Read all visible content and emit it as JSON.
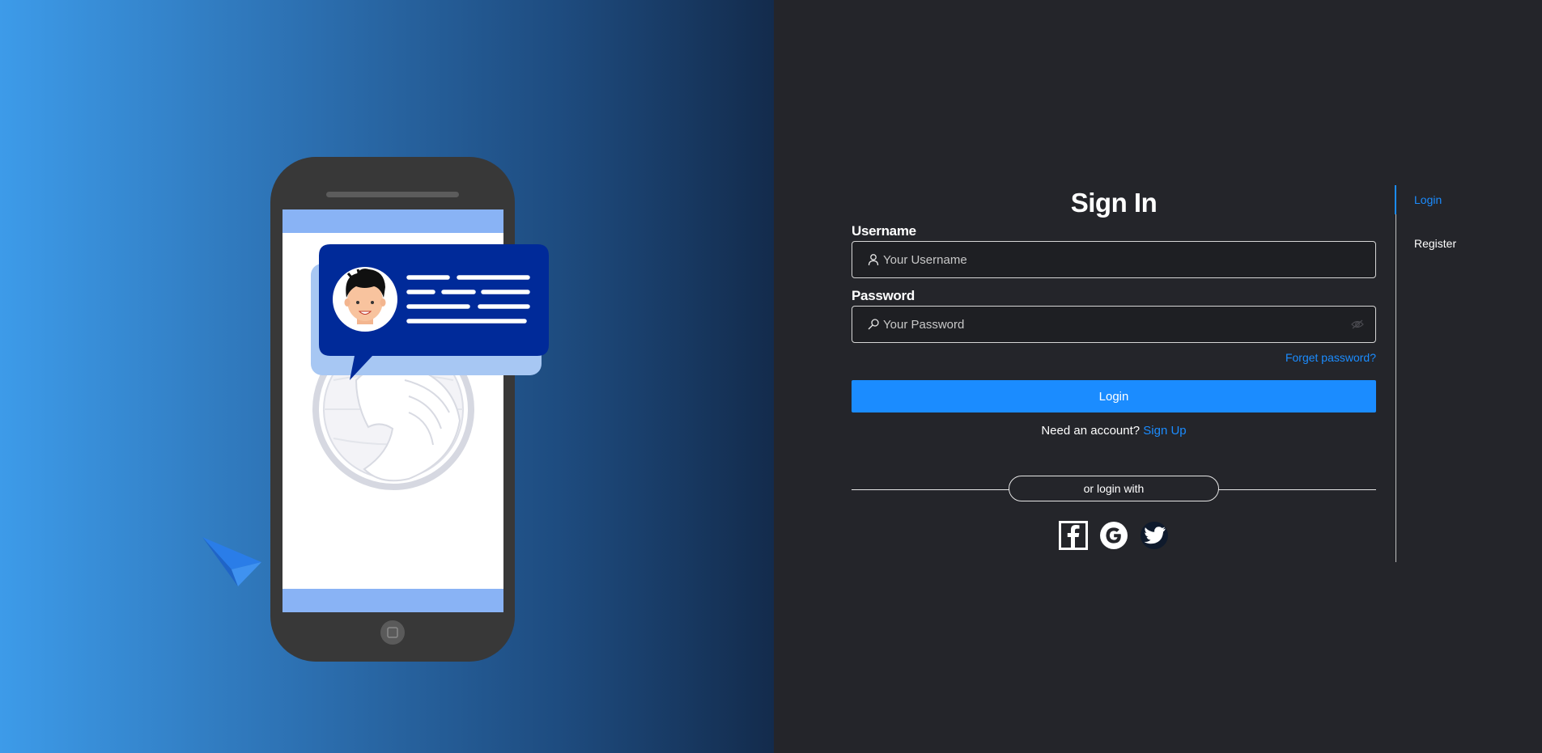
{
  "signin": {
    "title": "Sign In",
    "username_label": "Username",
    "username_placeholder": "Your Username",
    "password_label": "Password",
    "password_placeholder": "Your Password",
    "forgot_link": "Forget password?",
    "login_button": "Login",
    "need_account": "Need an account?",
    "signup_link": "Sign Up",
    "divider_text": "or login with"
  },
  "social": [
    {
      "name": "facebook-icon"
    },
    {
      "name": "google-icon"
    },
    {
      "name": "twitter-icon"
    }
  ],
  "sidenav": {
    "items": [
      {
        "label": "Login",
        "active": true
      },
      {
        "label": "Register",
        "active": false
      }
    ]
  },
  "colors": {
    "accent": "#1b8cff",
    "panel_bg": "#24252a",
    "hero_left": "#3d9be9",
    "hero_right": "#132b4c",
    "bubble": "#002a99"
  }
}
